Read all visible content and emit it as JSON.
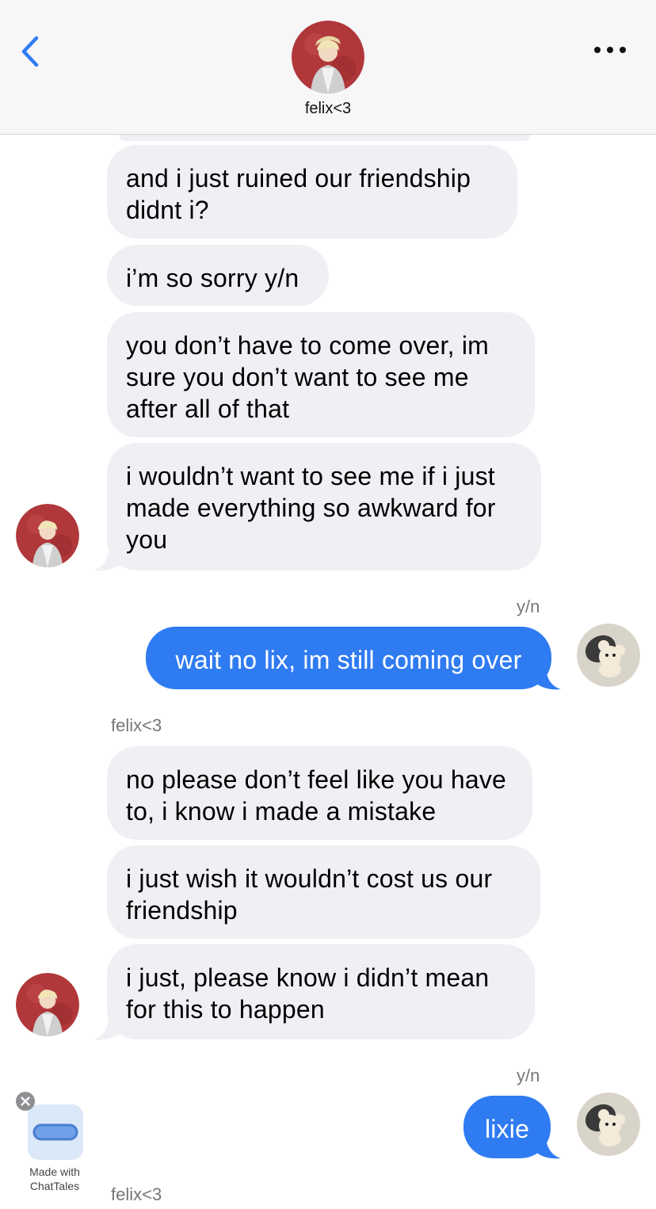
{
  "header": {
    "contact_name": "felix<3",
    "back_icon": "chevron-left-icon",
    "more_icon": "ellipsis-icon",
    "accent_color": "#2f7bf2"
  },
  "messages": [
    {
      "sender": "felix<3",
      "text": "and i just ruined our friendship didnt i?"
    },
    {
      "sender": "felix<3",
      "text": "i’m so sorry y/n"
    },
    {
      "sender": "felix<3",
      "text": "you don’t have to come over, im sure you don’t want to see me after all of that"
    },
    {
      "sender": "felix<3",
      "text": "i wouldn’t want to see me if i just made everything so awkward for you"
    },
    {
      "sender": "y/n",
      "text": "wait no lix, im still coming over"
    },
    {
      "sender": "felix<3",
      "text": "no please don’t feel like you have to, i know i made a mistake"
    },
    {
      "sender": "felix<3",
      "text": "i just wish it wouldn’t cost us our friendship"
    },
    {
      "sender": "felix<3",
      "text": "i just, please know i didn’t mean for this to happen"
    },
    {
      "sender": "y/n",
      "text": "lixie"
    }
  ],
  "labels": {
    "yn_1": "y/n",
    "felix_1": "felix<3",
    "yn_2": "y/n",
    "felix_2": "felix<3"
  },
  "badge": {
    "line1": "Made with",
    "line2": "ChatTales"
  },
  "colors": {
    "incoming_bubble": "#efeff4",
    "outgoing_bubble": "#2f7bf2"
  }
}
